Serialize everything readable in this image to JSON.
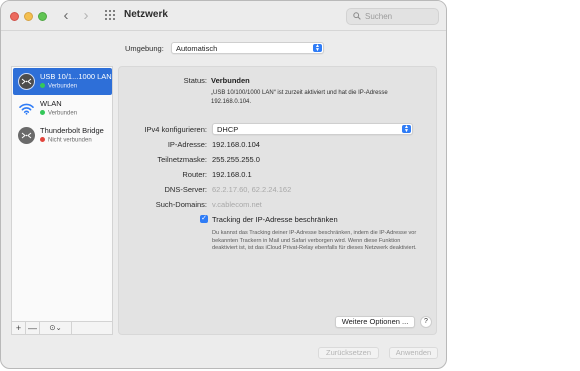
{
  "window": {
    "title": "Netzwerk",
    "search_placeholder": "Suchen"
  },
  "environment": {
    "label": "Umgebung:",
    "value": "Automatisch"
  },
  "sidebar": {
    "services": [
      {
        "name": "USB 10/1...1000 LAN",
        "status": "Verbunden",
        "status_color": "#34c759",
        "icon": "ethernet-icon",
        "selected": true
      },
      {
        "name": "WLAN",
        "status": "Verbunden",
        "status_color": "#34c759",
        "icon": "wifi-icon",
        "selected": false
      },
      {
        "name": "Thunderbolt Bridge",
        "status": "Nicht verbunden",
        "status_color": "#e2443b",
        "icon": "ethernet-icon",
        "selected": false
      }
    ],
    "add_label": "+",
    "remove_label": "—",
    "action_label": "⊙⌄"
  },
  "detail": {
    "status_label": "Status:",
    "status_value": "Verbunden",
    "status_description": "„USB 10/100/1000 LAN“ ist zurzeit aktiviert und hat die IP-Adresse 192.168.0.104.",
    "ipv4_label": "IPv4 konfigurieren:",
    "ipv4_value": "DHCP",
    "ip_label": "IP-Adresse:",
    "ip_value": "192.168.0.104",
    "subnet_label": "Teilnetzmaske:",
    "subnet_value": "255.255.255.0",
    "router_label": "Router:",
    "router_value": "192.168.0.1",
    "dns_label": "DNS-Server:",
    "dns_value": "62.2.17.60, 62.2.24.162",
    "search_domains_label": "Such-Domains:",
    "search_domains_value": "v.cablecom.net",
    "tracking_checked": true,
    "tracking_label": "Tracking der IP-Adresse beschränken",
    "tracking_help": "Du kannst das Tracking deiner IP-Adresse beschränken, indem die IP-Adresse vor bekannten Trackern in Mail und Safari verborgen wird. Wenn diese Funktion deaktiviert ist, ist das iCloud Privat-Relay ebenfalls für dieses Netzwerk deaktiviert.",
    "more_options_label": "Weitere Optionen ...",
    "help_label": "?"
  },
  "footer": {
    "revert_label": "Zurücksetzen",
    "apply_label": "Anwenden"
  },
  "colors": {
    "accent": "#2f7cf6",
    "selection": "#2e6fd8",
    "connected": "#34c759",
    "disconnected": "#e2443b"
  }
}
